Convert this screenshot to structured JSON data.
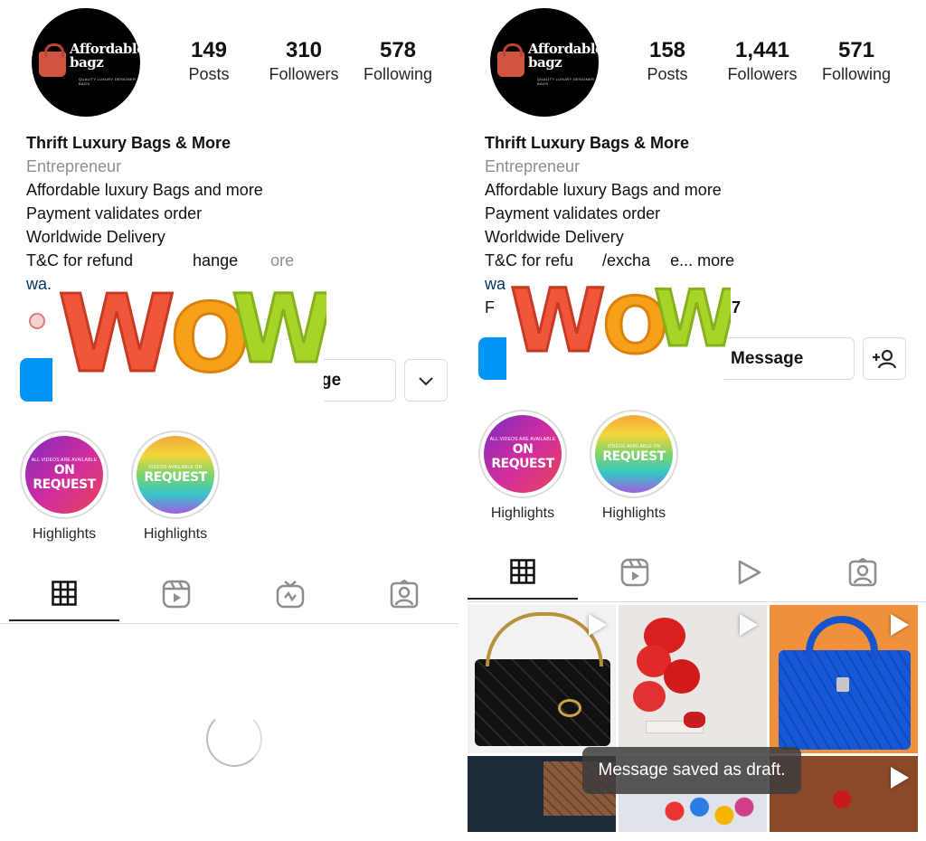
{
  "left": {
    "brand_line1": "Affordable",
    "brand_line2": "bagz",
    "brand_tagline": "QUALITY LUXURY DESIGNER BAGS",
    "stats": [
      {
        "num": "149",
        "label": "Posts"
      },
      {
        "num": "310",
        "label": "Followers"
      },
      {
        "num": "578",
        "label": "Following"
      }
    ],
    "bio": {
      "name": "Thrift Luxury Bags & More",
      "category": "Entrepreneur",
      "line1": "Affordable luxury Bags and more",
      "line2": "Payment validates order",
      "line3": "Worldwide Delivery",
      "line4a": "T&C for refund",
      "line4b": "hange",
      "line4c": "ore",
      "link": "wa.r"
    },
    "message_partial": "ge",
    "highlights": [
      {
        "top": "ALL VIDEOS ARE AVAILABLE",
        "big": "ON REQUEST",
        "caption": "Highlights"
      },
      {
        "top": "VIDEOS AVAILABLE ON",
        "big": "REQUEST",
        "caption": "Highlights"
      }
    ]
  },
  "right": {
    "brand_line1": "Affordable",
    "brand_line2": "bagz",
    "brand_tagline": "QUALITY LUXURY DESIGNER BAGS",
    "stats": [
      {
        "num": "158",
        "label": "Posts"
      },
      {
        "num": "1,441",
        "label": "Followers"
      },
      {
        "num": "571",
        "label": "Following"
      }
    ],
    "bio": {
      "name": "Thrift Luxury Bags & More",
      "category": "Entrepreneur",
      "line1": "Affordable luxury Bags and more",
      "line2": "Payment validates order",
      "line3": "Worldwide Delivery",
      "line4a": "T&C for refu",
      "line4b": "/excha",
      "line4c": "e... more",
      "link": "wa.",
      "line6a": "F",
      "line6b": "7"
    },
    "message_label": "Message",
    "highlights": [
      {
        "top": "ALL VIDEOS ARE AVAILABLE",
        "big": "ON REQUEST",
        "caption": "Highlights"
      },
      {
        "top": "VIDEOS AVAILABLE ON",
        "big": "REQUEST",
        "caption": "Highlights"
      }
    ],
    "toast": "Message saved as draft."
  },
  "overlay_text": "WOW",
  "colors": {
    "blue": "#0095f6",
    "link": "#00376b",
    "muted": "#8e8e8e"
  }
}
